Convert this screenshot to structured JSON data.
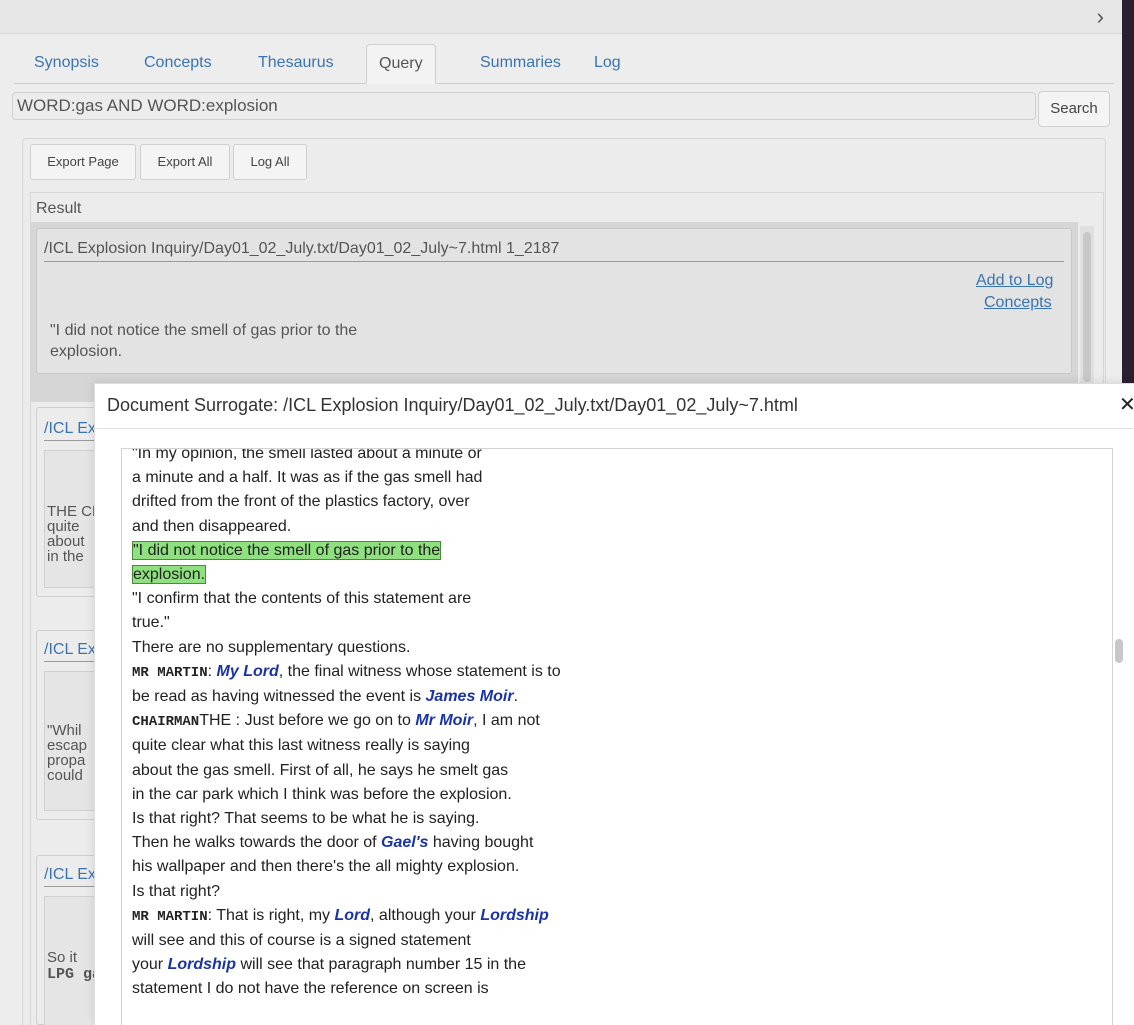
{
  "topbar": {
    "chevron": "›"
  },
  "tabs": [
    "Synopsis",
    "Concepts",
    "Thesaurus",
    "Query",
    "Summaries",
    "Log"
  ],
  "query": {
    "value": "WORD:gas AND WORD:explosion",
    "search_label": "Search"
  },
  "toolbar": {
    "export_page": "Export Page",
    "export_all": "Export All",
    "log_all": "Log All"
  },
  "result": {
    "title": "Result",
    "first": {
      "path": "/ICL Explosion Inquiry/Day01_02_July.txt/Day01_02_July~7.html 1_2187",
      "add_to_log": "Add to Log",
      "concepts": "Concepts",
      "text1": "\"I did not notice the smell of gas prior to the",
      "text2": "explosion."
    },
    "others": [
      {
        "path": "/ICL Explosion Inquiry",
        "snippet": [
          "THE CHAIRMAN",
          "quite",
          "about",
          "in the"
        ]
      },
      {
        "path": "/ICL Explosion Inquiry",
        "snippet": [
          "\"Whil",
          "escap",
          "propa",
          "could"
        ]
      },
      {
        "path": "/ICL Explosion Inquiry",
        "snippet": [
          "So it",
          "LPG gas"
        ]
      }
    ]
  },
  "modal": {
    "title": "Document Surrogate: /ICL Explosion Inquiry/Day01_02_July.txt/Day01_02_July~7.html",
    "close": "✕",
    "lines": [
      {
        "t": "\"In my opinion, the smell lasted about a minute or"
      },
      {
        "t": "a minute and a half. It was as if the gas smell had"
      },
      {
        "t": "drifted from the front of the plastics factory, over"
      },
      {
        "e": "Gael's",
        "t": " and then disappeared."
      },
      {
        "h": "\"I did not notice the smell of gas prior to the"
      },
      {
        "h": "explosion."
      },
      {
        "t": "\"I confirm that the contents of this statement are"
      },
      {
        "t": "true.\""
      },
      {
        "t": "There are no supplementary questions."
      },
      {
        "s": "MR MARTIN",
        "t": ": ",
        "e": "My Lord",
        "t2": ", the final witness whose statement is to"
      },
      {
        "t": "be read as having witnessed the event is ",
        "e": "James Moir",
        "t2": "."
      },
      {
        "t": "THE ",
        "s": "CHAIRMAN",
        "t1": ": Just before we go on to ",
        "e": "Mr Moir",
        "t2": ", I am not"
      },
      {
        "t": "quite clear what this last witness really is saying"
      },
      {
        "t": "about the gas smell. First of all, he says he smelt gas"
      },
      {
        "t": "in the car park which I think was before the explosion."
      },
      {
        "t": "Is that right? That seems to be what he is saying."
      },
      {
        "t": "Then he walks towards the door of ",
        "e": "Gael's",
        "t2": " having bought"
      },
      {
        "t": "his wallpaper and then there's the all mighty explosion."
      },
      {
        "t": "Is that right?"
      },
      {
        "s": "MR MARTIN",
        "t": ": That is right, my ",
        "e": "Lord",
        "t1": ", although your ",
        "e2": "Lordship"
      },
      {
        "t": "will see and this of course is a signed statement"
      },
      {
        "t": "your ",
        "e": "Lordship",
        "t2": " will see that paragraph number 15 in the"
      },
      {
        "t": "statement I do not have the reference on screen is"
      }
    ]
  }
}
